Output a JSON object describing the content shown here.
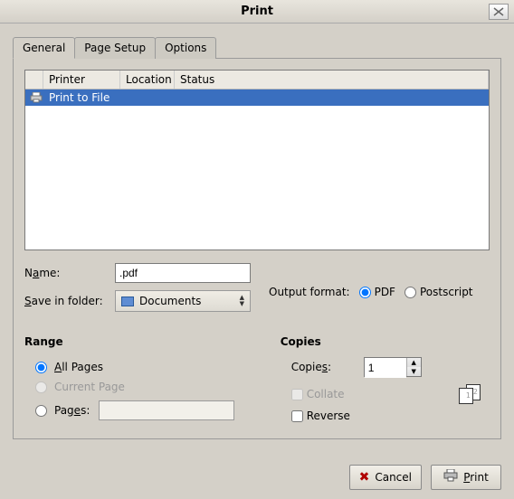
{
  "window": {
    "title": "Print"
  },
  "tabs": {
    "general": "General",
    "page_setup": "Page Setup",
    "options": "Options"
  },
  "printer_list": {
    "headers": {
      "printer": "Printer",
      "location": "Location",
      "status": "Status"
    },
    "rows": [
      {
        "name": "Print to File"
      }
    ]
  },
  "file_output": {
    "name_label_pre": "N",
    "name_label_accel": "a",
    "name_label_post": "me:",
    "name_value": ".pdf",
    "folder_label_pre": "",
    "folder_label_accel": "S",
    "folder_label_post": "ave in folder:",
    "folder_value": "Documents"
  },
  "output_format": {
    "label": "Output format:",
    "options": {
      "pdf": "PDF",
      "postscript": "Postscript"
    },
    "selected": "pdf"
  },
  "range": {
    "title": "Range",
    "all_accel": "A",
    "all_post": "ll Pages",
    "current": "Current Page",
    "pages_label_pre": "Pag",
    "pages_label_accel": "e",
    "pages_label_post": "s:",
    "pages_value": ""
  },
  "copies": {
    "title": "Copies",
    "copies_label_pre": "Copie",
    "copies_label_accel": "s",
    "copies_label_post": ":",
    "value": "1",
    "collate": "Collate",
    "reverse": "Reverse",
    "sheet1": "1",
    "sheet2": "2"
  },
  "buttons": {
    "cancel": "Cancel",
    "print_accel": "P",
    "print_post": "rint"
  }
}
